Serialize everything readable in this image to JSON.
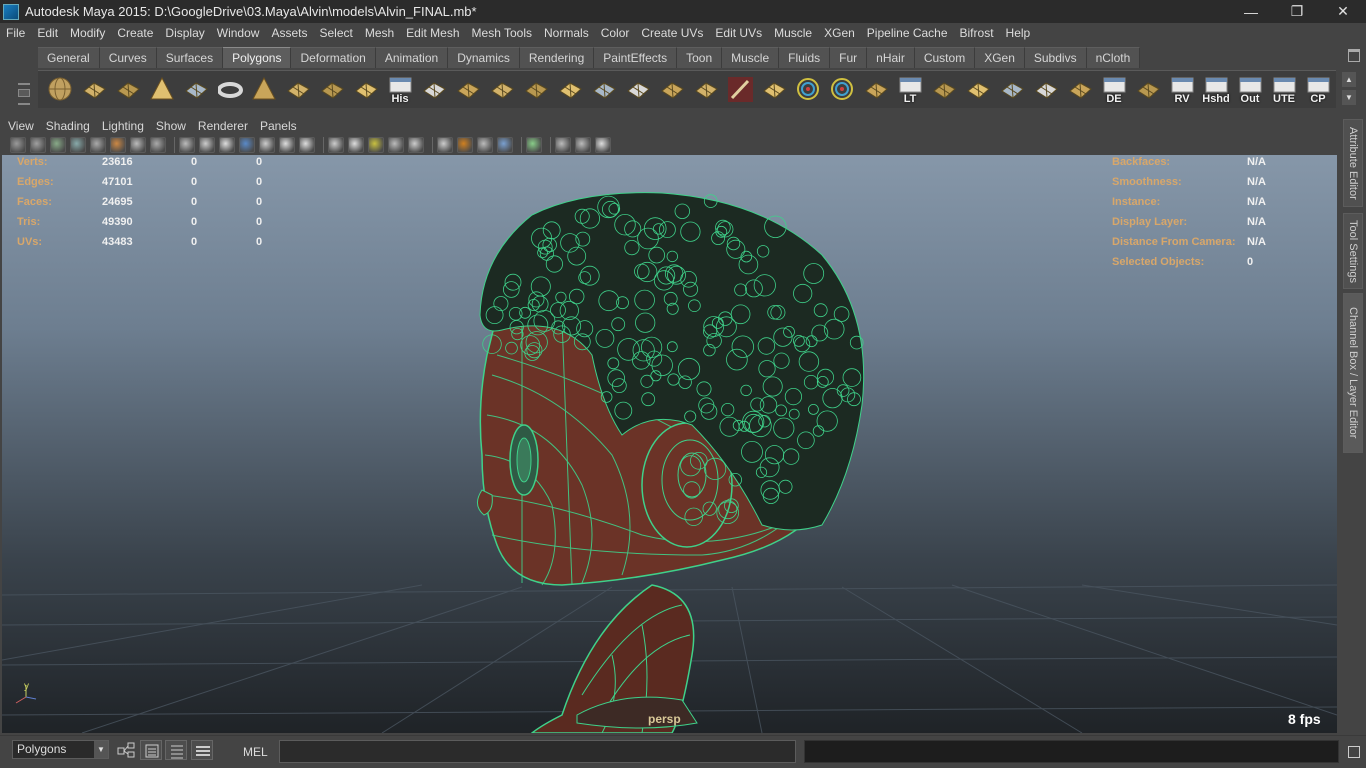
{
  "window": {
    "title": "Autodesk Maya 2015: D:\\GoogleDrive\\03.Maya\\Alvin\\models\\Alvin_FINAL.mb*",
    "minimize": "—",
    "restore": "❐",
    "close": "✕"
  },
  "menubar": [
    "File",
    "Edit",
    "Modify",
    "Create",
    "Display",
    "Window",
    "Assets",
    "Select",
    "Mesh",
    "Edit Mesh",
    "Mesh Tools",
    "Normals",
    "Color",
    "Create UVs",
    "Edit UVs",
    "Muscle",
    "XGen",
    "Pipeline Cache",
    "Bifrost",
    "Help"
  ],
  "shelf_tabs": [
    "General",
    "Curves",
    "Surfaces",
    "Polygons",
    "Deformation",
    "Animation",
    "Dynamics",
    "Rendering",
    "PaintEffects",
    "Toon",
    "Muscle",
    "Fluids",
    "Fur",
    "nHair",
    "Custom",
    "XGen",
    "Subdivs",
    "nCloth"
  ],
  "active_shelf_tab": "Polygons",
  "shelf_icons": [
    {
      "name": "poly-sphere-icon",
      "label": ""
    },
    {
      "name": "poly-cube-icon",
      "label": ""
    },
    {
      "name": "poly-cylinder-icon",
      "label": ""
    },
    {
      "name": "poly-cone-icon",
      "label": ""
    },
    {
      "name": "poly-plane-icon",
      "label": ""
    },
    {
      "name": "poly-torus-icon",
      "label": ""
    },
    {
      "name": "poly-pyramid-icon",
      "label": ""
    },
    {
      "name": "poly-pipe-icon",
      "label": ""
    },
    {
      "name": "create-polygon-tool-icon",
      "label": ""
    },
    {
      "name": "sculpt-geometry-icon",
      "label": ""
    },
    {
      "name": "history-icon",
      "label": "His"
    },
    {
      "name": "extrude-icon",
      "label": ""
    },
    {
      "name": "split-polygon-icon",
      "label": ""
    },
    {
      "name": "bridge-icon",
      "label": ""
    },
    {
      "name": "append-polygon-icon",
      "label": ""
    },
    {
      "name": "insert-edge-loop-icon",
      "label": ""
    },
    {
      "name": "offset-edge-icon",
      "label": ""
    },
    {
      "name": "merge-vertices-icon",
      "label": ""
    },
    {
      "name": "mirror-icon",
      "label": ""
    },
    {
      "name": "combine-icon",
      "label": ""
    },
    {
      "name": "paint-brush-icon",
      "label": ""
    },
    {
      "name": "lattice-icon",
      "label": ""
    },
    {
      "name": "rotate-manipulator-icon",
      "label": ""
    },
    {
      "name": "universal-manipulator-icon",
      "label": ""
    },
    {
      "name": "snap-icon",
      "label": ""
    },
    {
      "name": "lt-icon",
      "label": "LT"
    },
    {
      "name": "uv-layout-icon",
      "label": ""
    },
    {
      "name": "uv-unfold-icon",
      "label": ""
    },
    {
      "name": "uv-map-icon",
      "label": ""
    },
    {
      "name": "uv-sew-icon",
      "label": ""
    },
    {
      "name": "uv-select-icon",
      "label": ""
    },
    {
      "name": "de-icon",
      "label": "DE"
    },
    {
      "name": "uv-grid-icon",
      "label": ""
    },
    {
      "name": "rv-icon",
      "label": "RV"
    },
    {
      "name": "hshd-icon",
      "label": "Hshd"
    },
    {
      "name": "out-icon",
      "label": "Out"
    },
    {
      "name": "ute-icon",
      "label": "UTE"
    },
    {
      "name": "cp-icon",
      "label": "CP"
    }
  ],
  "panel_menus": [
    "View",
    "Shading",
    "Lighting",
    "Show",
    "Renderer",
    "Panels"
  ],
  "hud_left": [
    {
      "label": "Verts:",
      "a": "23616",
      "b": "0",
      "c": "0"
    },
    {
      "label": "Edges:",
      "a": "47101",
      "b": "0",
      "c": "0"
    },
    {
      "label": "Faces:",
      "a": "24695",
      "b": "0",
      "c": "0"
    },
    {
      "label": "Tris:",
      "a": "49390",
      "b": "0",
      "c": "0"
    },
    {
      "label": "UVs:",
      "a": "43483",
      "b": "0",
      "c": "0"
    }
  ],
  "hud_right": [
    {
      "label": "Backfaces:",
      "value": "N/A"
    },
    {
      "label": "Smoothness:",
      "value": "N/A"
    },
    {
      "label": "Instance:",
      "value": "N/A"
    },
    {
      "label": "Display Layer:",
      "value": "N/A"
    },
    {
      "label": "Distance From Camera:",
      "value": "N/A"
    },
    {
      "label": "Selected Objects:",
      "value": "0"
    }
  ],
  "camera": "persp",
  "fps": "8 fps",
  "axis": {
    "y": "y",
    "x": "x"
  },
  "side_tabs": [
    "Attribute Editor",
    "Tool Settings",
    "Channel Box / Layer Editor"
  ],
  "bottom": {
    "mode": "Polygons",
    "mel_label": "MEL"
  },
  "colors": {
    "wire": "#3fd18a",
    "skin": "#6b3327",
    "hud_label": "#d8a76a"
  }
}
